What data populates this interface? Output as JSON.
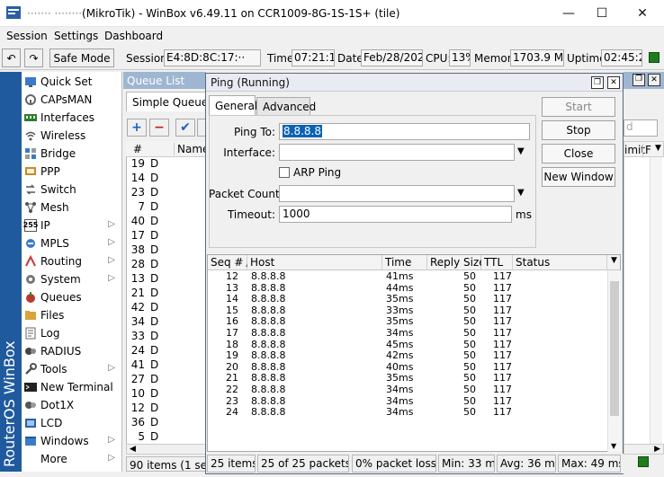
{
  "window": {
    "title": "(MikroTik) - WinBox v6.49.11 on CCR1009-8G-1S-1S+ (tile)",
    "title_prefix_redacted": "······· ········",
    "minimize": "—",
    "maximize": "☐",
    "close": "✕"
  },
  "menu": [
    "Session",
    "Settings",
    "Dashboard"
  ],
  "toolbar": {
    "undo": "↶",
    "redo": "↷",
    "safe_mode": "Safe Mode",
    "session_label": "Session:",
    "session_value": "E4:8D:8C:17:··",
    "time_label": "Time:",
    "time_value": "07:21:13",
    "date_label": "Date:",
    "date_value": "Feb/28/2024",
    "cpu_label": "CPU:",
    "cpu_value": "13%",
    "memory_label": "Memory:",
    "memory_value": "1703.9 MiB",
    "uptime_label": "Uptime:",
    "uptime_value": "02:45:22"
  },
  "sidebar": {
    "vertical_title": "RouterOS WinBox",
    "items": [
      {
        "label": "Quick Set",
        "icon": "quickset-icon",
        "submenu": false
      },
      {
        "label": "CAPsMAN",
        "icon": "capsman-icon",
        "submenu": false
      },
      {
        "label": "Interfaces",
        "icon": "interfaces-icon",
        "submenu": false
      },
      {
        "label": "Wireless",
        "icon": "wireless-icon",
        "submenu": false
      },
      {
        "label": "Bridge",
        "icon": "bridge-icon",
        "submenu": false
      },
      {
        "label": "PPP",
        "icon": "ppp-icon",
        "submenu": false
      },
      {
        "label": "Switch",
        "icon": "switch-icon",
        "submenu": false
      },
      {
        "label": "Mesh",
        "icon": "mesh-icon",
        "submenu": false
      },
      {
        "label": "IP",
        "icon": "ip-icon",
        "submenu": true
      },
      {
        "label": "MPLS",
        "icon": "mpls-icon",
        "submenu": true
      },
      {
        "label": "Routing",
        "icon": "routing-icon",
        "submenu": true
      },
      {
        "label": "System",
        "icon": "system-icon",
        "submenu": true
      },
      {
        "label": "Queues",
        "icon": "queues-icon",
        "submenu": false
      },
      {
        "label": "Files",
        "icon": "files-icon",
        "submenu": false
      },
      {
        "label": "Log",
        "icon": "log-icon",
        "submenu": false
      },
      {
        "label": "RADIUS",
        "icon": "radius-icon",
        "submenu": false
      },
      {
        "label": "Tools",
        "icon": "tools-icon",
        "submenu": true
      },
      {
        "label": "New Terminal",
        "icon": "terminal-icon",
        "submenu": false
      },
      {
        "label": "Dot1X",
        "icon": "dot1x-icon",
        "submenu": false
      },
      {
        "label": "LCD",
        "icon": "lcd-icon",
        "submenu": false
      },
      {
        "label": "Windows",
        "icon": "windows-icon",
        "submenu": true
      },
      {
        "label": "More",
        "icon": "",
        "submenu": true
      }
    ]
  },
  "queue_list": {
    "title": "Queue List",
    "tab": "Simple Queues",
    "col_hash": "#",
    "col_name": "Name",
    "right_cols": [
      "imit",
      "F"
    ],
    "rows": [
      "19",
      "14",
      "23",
      "7",
      "40",
      "17",
      "38",
      "28",
      "13",
      "21",
      "42",
      "34",
      "33",
      "24",
      "41",
      "27",
      "10",
      "12",
      "36",
      "5"
    ],
    "row_flag": "D",
    "status": "90 items (1 selecte"
  },
  "ping": {
    "title": "Ping (Running)",
    "tabs": [
      "General",
      "Advanced"
    ],
    "ping_to_label": "Ping To:",
    "ping_to_value": "8.8.8.8",
    "interface_label": "Interface:",
    "arp_ping_label": "ARP Ping",
    "packet_count_label": "Packet Count:",
    "timeout_label": "Timeout:",
    "timeout_value": "1000",
    "timeout_unit": "ms",
    "buttons": {
      "start": "Start",
      "stop": "Stop",
      "close": "Close",
      "new_window": "New Window"
    },
    "columns": [
      "Seq #",
      "Host",
      "Time",
      "Reply Size",
      "TTL",
      "Status"
    ],
    "rows": [
      {
        "seq": "12",
        "host": "8.8.8.8",
        "time": "41ms",
        "size": "50",
        "ttl": "117"
      },
      {
        "seq": "13",
        "host": "8.8.8.8",
        "time": "44ms",
        "size": "50",
        "ttl": "117"
      },
      {
        "seq": "14",
        "host": "8.8.8.8",
        "time": "35ms",
        "size": "50",
        "ttl": "117"
      },
      {
        "seq": "15",
        "host": "8.8.8.8",
        "time": "33ms",
        "size": "50",
        "ttl": "117"
      },
      {
        "seq": "16",
        "host": "8.8.8.8",
        "time": "35ms",
        "size": "50",
        "ttl": "117"
      },
      {
        "seq": "17",
        "host": "8.8.8.8",
        "time": "34ms",
        "size": "50",
        "ttl": "117"
      },
      {
        "seq": "18",
        "host": "8.8.8.8",
        "time": "45ms",
        "size": "50",
        "ttl": "117"
      },
      {
        "seq": "19",
        "host": "8.8.8.8",
        "time": "42ms",
        "size": "50",
        "ttl": "117"
      },
      {
        "seq": "20",
        "host": "8.8.8.8",
        "time": "40ms",
        "size": "50",
        "ttl": "117"
      },
      {
        "seq": "21",
        "host": "8.8.8.8",
        "time": "35ms",
        "size": "50",
        "ttl": "117"
      },
      {
        "seq": "22",
        "host": "8.8.8.8",
        "time": "34ms",
        "size": "50",
        "ttl": "117"
      },
      {
        "seq": "23",
        "host": "8.8.8.8",
        "time": "34ms",
        "size": "50",
        "ttl": "117"
      },
      {
        "seq": "24",
        "host": "8.8.8.8",
        "time": "34ms",
        "size": "50",
        "ttl": "117"
      }
    ],
    "status_items": "25 items",
    "status_packets": "25 of 25 packets r...",
    "status_loss": "0% packet loss",
    "status_min": "Min: 33 ms",
    "status_avg": "Avg: 36 ms",
    "status_max": "Max: 49 ms"
  },
  "colors": {
    "sidebar": "#1f5a9e",
    "accent": "#0a62b6",
    "queue_title": "#9eb6d2"
  }
}
